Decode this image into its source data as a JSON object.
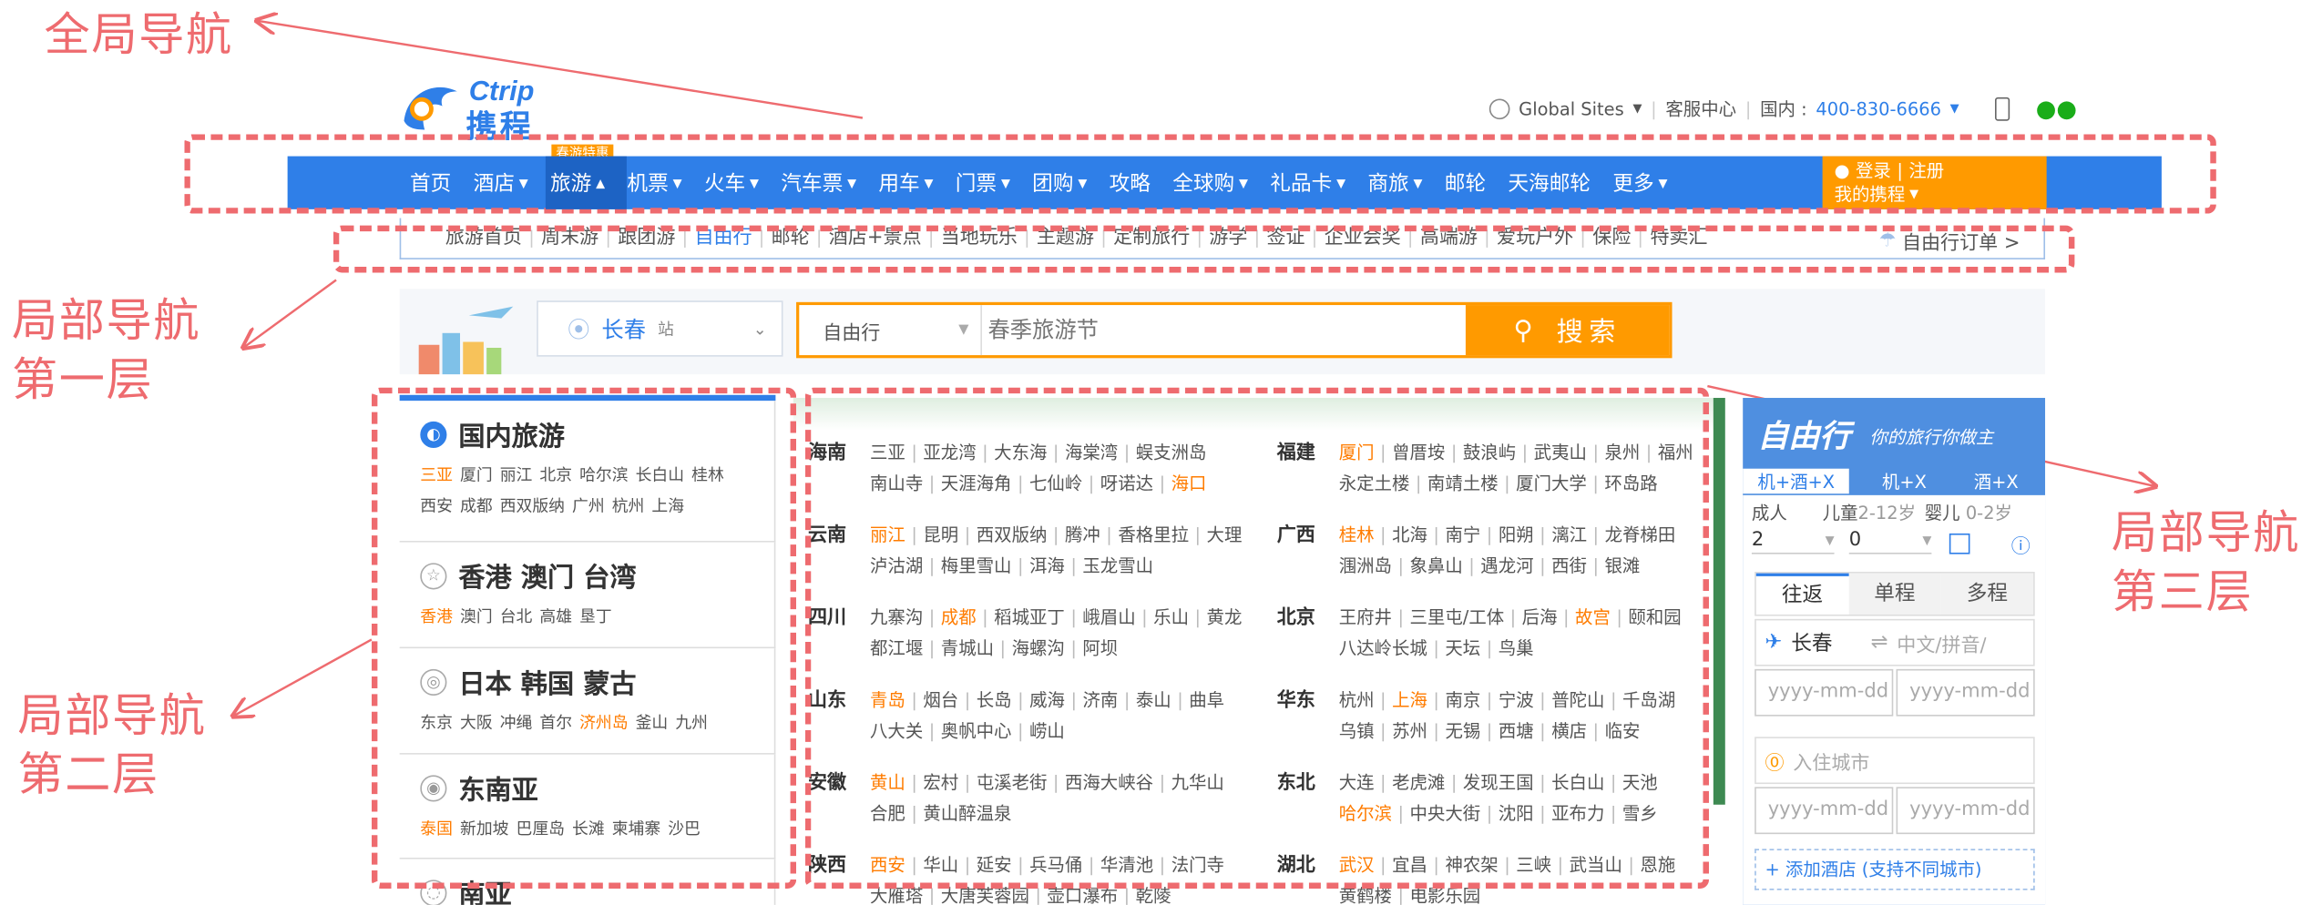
{
  "annotations": {
    "global_nav": "全局导航",
    "local_nav_1_a": "局部导航",
    "local_nav_1_b": "第一层",
    "local_nav_2_a": "局部导航",
    "local_nav_2_b": "第二层",
    "local_nav_3_a": "局部导航",
    "local_nav_3_b": "第三层"
  },
  "logo": {
    "latin": "Ctrip",
    "chinese": "携程"
  },
  "topbar": {
    "global_sites": "Global Sites",
    "service": "客服中心",
    "domestic_label": "国内 :",
    "phone": "400-830-6666"
  },
  "main_nav": {
    "items": [
      {
        "label": "首页",
        "caret": false
      },
      {
        "label": "酒店",
        "caret": true
      },
      {
        "label": "旅游",
        "caret": true
      },
      {
        "label": "机票",
        "caret": true
      },
      {
        "label": "火车",
        "caret": true
      },
      {
        "label": "汽车票",
        "caret": true
      },
      {
        "label": "用车",
        "caret": true
      },
      {
        "label": "门票",
        "caret": true
      },
      {
        "label": "团购",
        "caret": true
      },
      {
        "label": "攻略",
        "caret": false
      },
      {
        "label": "全球购",
        "caret": true
      },
      {
        "label": "礼品卡",
        "caret": true
      },
      {
        "label": "商旅",
        "caret": true
      },
      {
        "label": "邮轮",
        "caret": false
      },
      {
        "label": "天海邮轮",
        "caret": false
      },
      {
        "label": "更多",
        "caret": true
      }
    ],
    "promo_badge": "春游特惠",
    "login": "登录",
    "register": "注册",
    "my_ctrip": "我的携程"
  },
  "sub_nav": {
    "items": [
      "旅游首页",
      "周末游",
      "跟团游",
      "自由行",
      "邮轮",
      "酒店+景点",
      "当地玩乐",
      "主题游",
      "定制旅行",
      "游学",
      "签证",
      "企业会奖",
      "高端游",
      "爱玩户外",
      "保险",
      "特卖汇"
    ],
    "active_index": 3,
    "order_link": "自由行订单 >"
  },
  "search": {
    "city": "长春",
    "city_suffix": "站",
    "type": "自由行",
    "placeholder": "春季旅游节",
    "button": "搜索"
  },
  "categories": [
    {
      "title": "国内旅游",
      "icon": "china-icon",
      "lines": [
        [
          "三亚",
          "厦门",
          "丽江",
          "北京",
          "哈尔滨",
          "长白山",
          "桂林"
        ],
        [
          "西安",
          "成都",
          "西双版纳",
          "广州",
          "杭州",
          "上海"
        ]
      ],
      "highlight": [
        "三亚"
      ]
    },
    {
      "title": "香港  澳门  台湾",
      "icon": "star-icon",
      "lines": [
        [
          "香港",
          "澳门",
          "台北",
          "高雄",
          "垦丁"
        ]
      ],
      "highlight": [
        "香港"
      ]
    },
    {
      "title": "日本  韩国  蒙古",
      "icon": "fan-icon",
      "lines": [
        [
          "东京",
          "大阪",
          "冲绳",
          "首尔",
          "济州岛",
          "釜山",
          "九州"
        ]
      ],
      "highlight": [
        "济州岛"
      ]
    },
    {
      "title": "东南亚",
      "icon": "buddha-icon",
      "lines": [
        [
          "泰国",
          "新加坡",
          "巴厘岛",
          "长滩",
          "柬埔寨",
          "沙巴"
        ]
      ],
      "highlight": [
        "泰国"
      ]
    },
    {
      "title": "南亚",
      "icon": "temple-icon",
      "lines": [],
      "highlight": []
    }
  ],
  "regions_left": [
    {
      "name": "海南",
      "lines": [
        [
          "三亚",
          "亚龙湾",
          "大东海",
          "海棠湾",
          "蜈支洲岛"
        ],
        [
          "南山寺",
          "天涯海角",
          "七仙岭",
          "呀诺达",
          "海口"
        ]
      ],
      "highlight": [
        "海口"
      ]
    },
    {
      "name": "云南",
      "lines": [
        [
          "丽江",
          "昆明",
          "西双版纳",
          "腾冲",
          "香格里拉",
          "大理"
        ],
        [
          "泸沽湖",
          "梅里雪山",
          "洱海",
          "玉龙雪山"
        ]
      ],
      "highlight": [
        "丽江"
      ]
    },
    {
      "name": "四川",
      "lines": [
        [
          "九寨沟",
          "成都",
          "稻城亚丁",
          "峨眉山",
          "乐山",
          "黄龙"
        ],
        [
          "都江堰",
          "青城山",
          "海螺沟",
          "阿坝"
        ]
      ],
      "highlight": [
        "成都"
      ]
    },
    {
      "name": "山东",
      "lines": [
        [
          "青岛",
          "烟台",
          "长岛",
          "威海",
          "济南",
          "泰山",
          "曲阜"
        ],
        [
          "八大关",
          "奥帆中心",
          "崂山"
        ]
      ],
      "highlight": [
        "青岛"
      ]
    },
    {
      "name": "安徽",
      "lines": [
        [
          "黄山",
          "宏村",
          "屯溪老街",
          "西海大峡谷",
          "九华山"
        ],
        [
          "合肥",
          "黄山醉温泉"
        ]
      ],
      "highlight": [
        "黄山"
      ]
    },
    {
      "name": "陕西",
      "lines": [
        [
          "西安",
          "华山",
          "延安",
          "兵马俑",
          "华清池",
          "法门寺"
        ],
        [
          "大雁塔",
          "大唐芙蓉园",
          "壶口瀑布",
          "乾陵"
        ]
      ],
      "highlight": [
        "西安"
      ]
    }
  ],
  "regions_right": [
    {
      "name": "福建",
      "lines": [
        [
          "厦门",
          "曾厝垵",
          "鼓浪屿",
          "武夷山",
          "泉州",
          "福州"
        ],
        [
          "永定土楼",
          "南靖土楼",
          "厦门大学",
          "环岛路"
        ]
      ],
      "highlight": [
        "厦门"
      ]
    },
    {
      "name": "广西",
      "lines": [
        [
          "桂林",
          "北海",
          "南宁",
          "阳朔",
          "漓江",
          "龙脊梯田"
        ],
        [
          "涠洲岛",
          "象鼻山",
          "遇龙河",
          "西街",
          "银滩"
        ]
      ],
      "highlight": [
        "桂林"
      ]
    },
    {
      "name": "北京",
      "lines": [
        [
          "王府井",
          "三里屯/工体",
          "后海",
          "故宫",
          "颐和园"
        ],
        [
          "八达岭长城",
          "天坛",
          "鸟巢"
        ]
      ],
      "highlight": [
        "故宫"
      ]
    },
    {
      "name": "华东",
      "lines": [
        [
          "杭州",
          "上海",
          "南京",
          "宁波",
          "普陀山",
          "千岛湖"
        ],
        [
          "乌镇",
          "苏州",
          "无锡",
          "西塘",
          "横店",
          "临安"
        ]
      ],
      "highlight": [
        "上海"
      ]
    },
    {
      "name": "东北",
      "lines": [
        [
          "大连",
          "老虎滩",
          "发现王国",
          "长白山",
          "天池"
        ],
        [
          "哈尔滨",
          "中央大街",
          "沈阳",
          "亚布力",
          "雪乡"
        ]
      ],
      "highlight": [
        "哈尔滨"
      ]
    },
    {
      "name": "湖北",
      "lines": [
        [
          "武汉",
          "宜昌",
          "神农架",
          "三峡",
          "武当山",
          "恩施"
        ],
        [
          "黄鹤楼",
          "电影乐园"
        ]
      ],
      "highlight": [
        "武汉"
      ]
    }
  ],
  "booking": {
    "title": "自由行",
    "slogan": "你的旅行你做主",
    "tabs": [
      "机+酒+X",
      "机+X",
      "酒+X"
    ],
    "adult_label": "成人",
    "child_label": "儿童",
    "child_age": "2-12岁",
    "infant_label": "婴儿",
    "infant_age": "0-2岁",
    "adult_value": "2",
    "child_value": "0",
    "trip_tabs": [
      "往返",
      "单程",
      "多程"
    ],
    "from_city": "长春",
    "to_placeholder": "中文/拼音/",
    "date_placeholder": "yyyy-mm-dd",
    "hotel_city_placeholder": "入住城市",
    "add_hotel": "+ 添加酒店 (支持不同城市)"
  },
  "colors": {
    "annotation": "#ee6b6f",
    "nav_blue": "#2f7fe8",
    "orange": "#ff9a00",
    "highlight": "#ff7c00"
  }
}
